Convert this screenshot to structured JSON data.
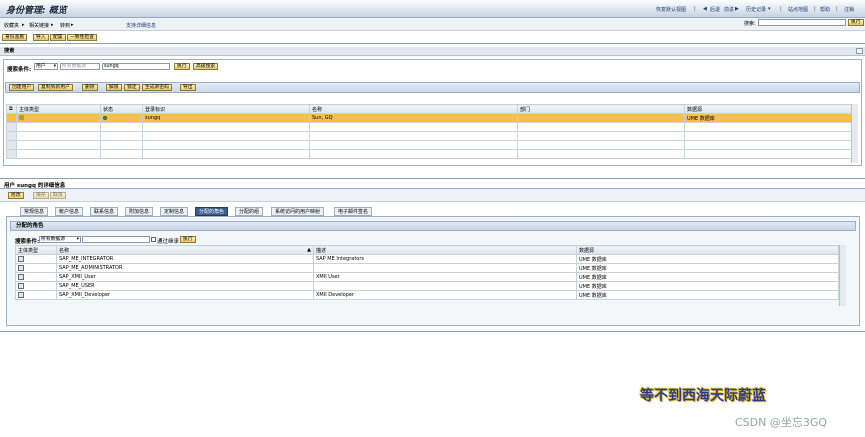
{
  "header": {
    "title": "身份管理: 概览",
    "links": [
      "恢复默认视图",
      "后退",
      "前进",
      "历史记录",
      "站点地图",
      "帮助",
      "注销"
    ]
  },
  "menubar": {
    "items": [
      "收藏夹",
      "相关链接",
      "转到"
    ],
    "support_link": "支持详细信息",
    "search_label": "搜索:",
    "search_value": "",
    "search_button": "执行"
  },
  "toolbar": {
    "buttons": [
      "身份查看",
      "导入",
      "配置",
      "一致性检查"
    ]
  },
  "search_section": {
    "title": "搜索",
    "criteria_label": "搜索条件:",
    "type_select": "用户",
    "datasource_placeholder": "所有数据源",
    "query": "sungq",
    "execute_button": "执行",
    "advanced_button": "高级搜索"
  },
  "result_toolbar": {
    "buttons": [
      "创建用户",
      "复制到新用户",
      "删除",
      "解锁",
      "锁定",
      "生成新密码",
      "导出"
    ]
  },
  "result_table": {
    "columns": [
      "主体类型",
      "状态",
      "登录标识",
      "名称",
      "部门",
      "数据源"
    ],
    "rows": [
      {
        "login": "sungq",
        "name": "Sun, GQ",
        "dept": "",
        "source": "UME 数据库"
      }
    ]
  },
  "details": {
    "title": "用户 sungq 的详细信息",
    "buttons": [
      "修改",
      "保存",
      "取消"
    ],
    "tabs": [
      "常规信息",
      "帐户信息",
      "联系信息",
      "附加信息",
      "定制信息",
      "分配的角色",
      "分配的组",
      "系统访问的用户映射",
      "电子邮件签名"
    ],
    "active_tab": 5,
    "roles_title": "分配的角色",
    "roles_search_label": "搜索条件:",
    "roles_search_select": "所有数据源",
    "roles_search_value": "",
    "roles_inherit_label": "通过继承",
    "roles_search_button": "执行",
    "roles_columns": [
      "主体类型",
      "名称",
      "描述",
      "数据源"
    ],
    "roles": [
      {
        "name": "SAP_ME_INTEGRATOR",
        "desc": "SAP ME Integrators",
        "source": "UME 数据库"
      },
      {
        "name": "SAP_ME_ADMINISTRATOR",
        "desc": "",
        "source": "UME 数据库"
      },
      {
        "name": "SAP_XMII_User",
        "desc": "XMII User",
        "source": "UME 数据库"
      },
      {
        "name": "SAP_ME_USER",
        "desc": "",
        "source": "UME 数据库"
      },
      {
        "name": "SAP_XMII_Developer",
        "desc": "XMII Developer",
        "source": "UME 数据库"
      }
    ]
  },
  "watermark": {
    "text": "等不到西海天际蔚蓝",
    "csdn": "CSDN @坐忘3GQ"
  }
}
